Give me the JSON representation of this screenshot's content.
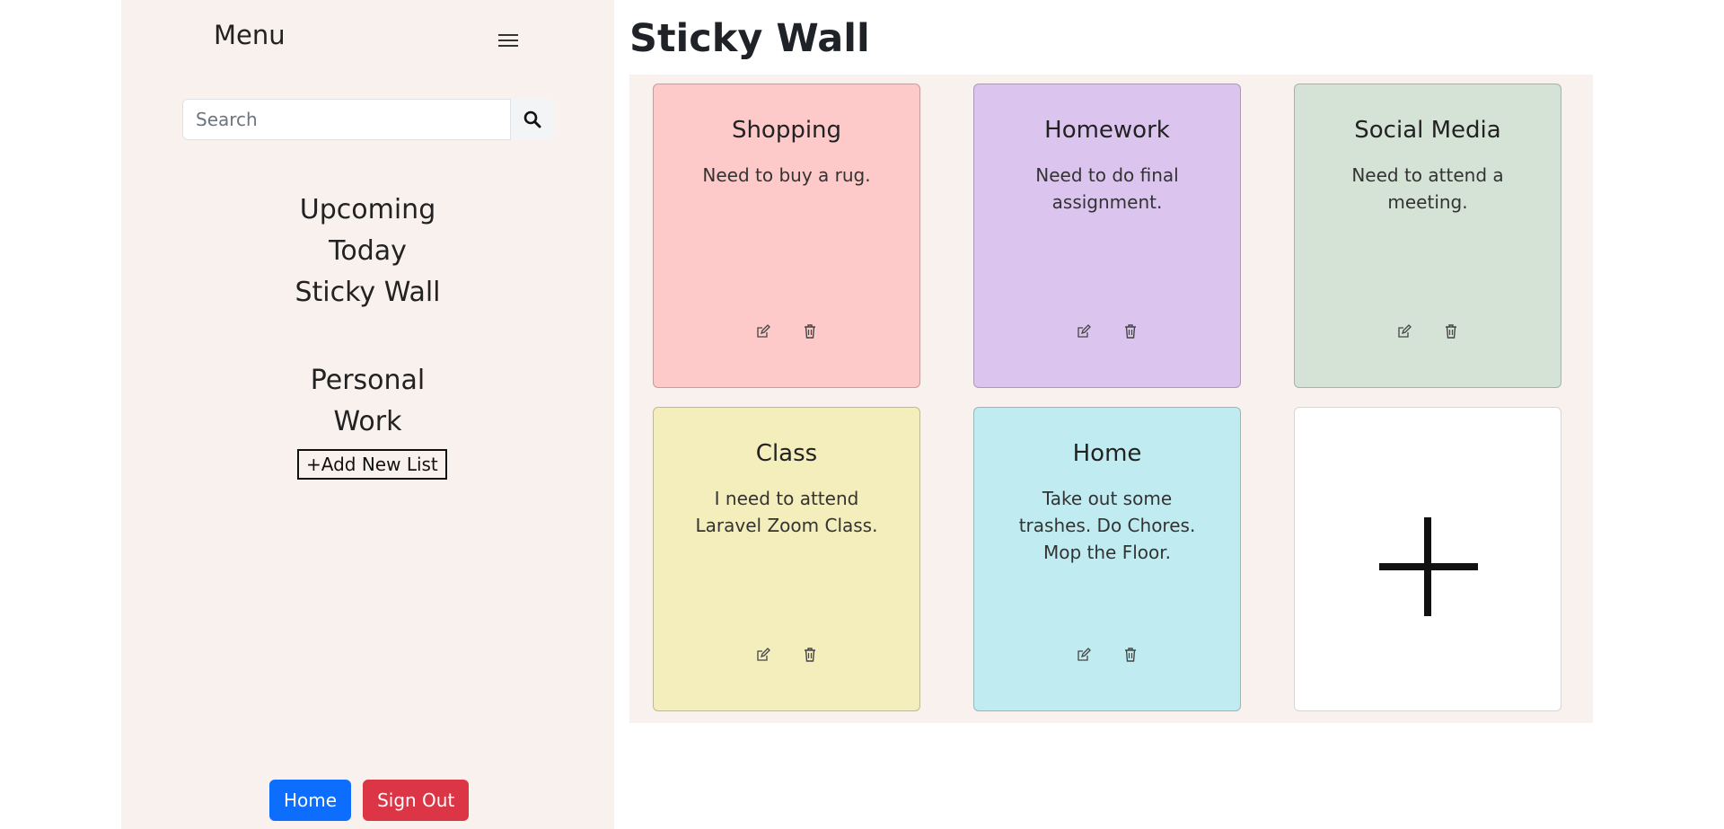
{
  "sidebar": {
    "menu_title": "Menu",
    "search_placeholder": "Search",
    "nav_tasks": [
      "Upcoming",
      "Today",
      "Sticky Wall"
    ],
    "nav_lists": [
      "Personal",
      "Work"
    ],
    "add_list_label": "+Add New List",
    "home_label": "Home",
    "signout_label": "Sign Out"
  },
  "main": {
    "title": "Sticky Wall",
    "notes": [
      {
        "title": "Shopping",
        "body": "Need to buy a rug.",
        "color": "#fec9c9"
      },
      {
        "title": "Homework",
        "body": "Need to do final assignment.",
        "color": "#dbc5ef"
      },
      {
        "title": "Social Media",
        "body": "Need to attend a meeting.",
        "color": "#d5e3d6"
      },
      {
        "title": "Class",
        "body": "I need to attend Laravel Zoom Class.",
        "color": "#f4eebc"
      },
      {
        "title": "Home",
        "body": "Take out some trashes. Do Chores. Mop the Floor.",
        "color": "#c0ecf1"
      }
    ]
  },
  "colors": {
    "sidebar_bg": "#f9f1ee",
    "home_btn": "#0d6efd",
    "signout_btn": "#dc3545"
  },
  "icons": {
    "menu": "hamburger-icon",
    "search": "magnifier-icon",
    "edit": "edit-icon",
    "delete": "trash-icon",
    "add": "plus-icon"
  }
}
